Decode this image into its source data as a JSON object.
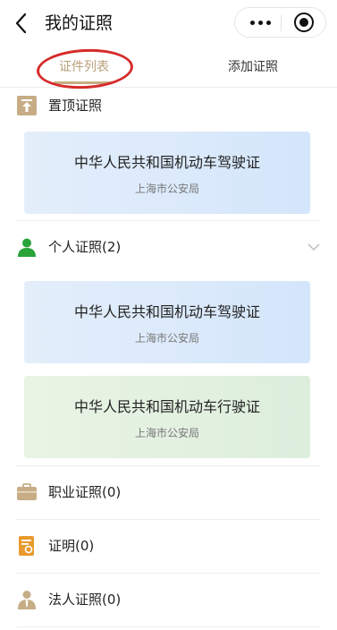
{
  "nav": {
    "title": "我的证照"
  },
  "tabs": [
    {
      "label": "证件列表"
    },
    {
      "label": "添加证照"
    }
  ],
  "pinned": {
    "label": "置顶证照",
    "card": {
      "title": "中华人民共和国机动车驾驶证",
      "issuer": "上海市公安局"
    }
  },
  "personal": {
    "label": "个人证照(2)",
    "cards": [
      {
        "title": "中华人民共和国机动车驾驶证",
        "issuer": "上海市公安局"
      },
      {
        "title": "中华人民共和国机动车行驶证",
        "issuer": "上海市公安局"
      }
    ]
  },
  "professional": {
    "label": "职业证照(0)"
  },
  "certificates": {
    "label": "证明(0)"
  },
  "legal": {
    "label": "法人证照(0)"
  },
  "colors": {
    "accent": "#c7ad84",
    "annotation": "#d62b2b",
    "green_icon": "#27a33a",
    "card_blue": "#d4e6fb",
    "card_green": "#ddeedd"
  },
  "icons": {
    "back": "back-arrow-icon",
    "more": "more-dots-icon",
    "close": "target-close-icon",
    "pinned": "pin-top-icon",
    "personal": "person-icon",
    "professional": "briefcase-icon",
    "certificates": "certificate-icon",
    "legal": "legal-person-icon",
    "expand": "chevron-down-icon"
  }
}
